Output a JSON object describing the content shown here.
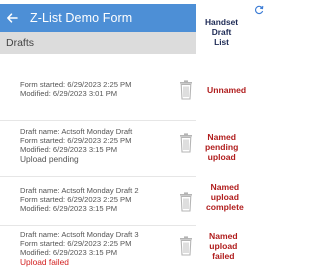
{
  "app": {
    "title": "Z-List Demo Form"
  },
  "section": {
    "title": "Drafts"
  },
  "forms": [
    {
      "lines": [
        "Form started: 6/29/2023 2:25 PM",
        "Modified: 6/29/2023 3:01 PM"
      ],
      "status": "",
      "annotation": [
        "Unnamed"
      ]
    },
    {
      "lines": [
        "Draft name: Actsoft Monday Draft",
        "Form started: 6/29/2023 2:25 PM",
        "Modified: 6/29/2023 3:15 PM"
      ],
      "status": "Upload pending",
      "annotation": [
        "Named",
        "pending",
        "upload"
      ]
    },
    {
      "lines": [
        "Draft name: Actsoft Monday Draft 2",
        "Form started: 6/29/2023 2:25 PM",
        "Modified: 6/29/2023 3:15 PM"
      ],
      "status": "",
      "annotation": [
        "Named",
        "upload",
        "complete"
      ]
    },
    {
      "lines": [
        "Draft name: Actsoft Monday Draft 3",
        "Form started: 6/29/2023 2:25 PM",
        "Modified: 6/29/2023 3:15 PM"
      ],
      "status": "Upload failed",
      "annotation": [
        "Named",
        "upload",
        "failed"
      ]
    }
  ],
  "handset_caption": [
    "Handset",
    "Draft",
    "List"
  ],
  "icons": {
    "back": "arrow-left-icon",
    "trash": "trash-icon",
    "sync": "sync-icon"
  },
  "colors": {
    "appbar": "#4d8fd6",
    "subheader": "#dcdcdc",
    "annotation": "#b01d1d",
    "failed": "#d21f1f",
    "caption": "#1d2a55"
  }
}
